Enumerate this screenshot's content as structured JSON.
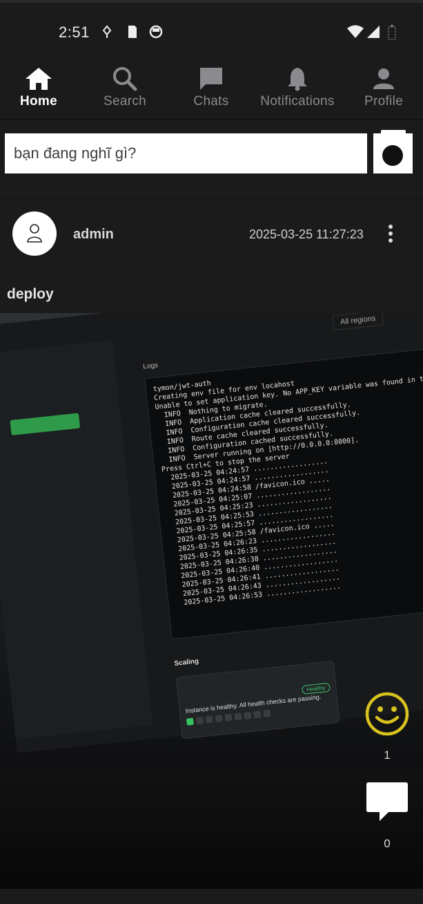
{
  "status_bar": {
    "time": "2:51"
  },
  "nav": {
    "items": [
      {
        "label": "Home",
        "icon": "home-icon",
        "active": true
      },
      {
        "label": "Search",
        "icon": "search-icon",
        "active": false
      },
      {
        "label": "Chats",
        "icon": "chat-icon",
        "active": false
      },
      {
        "label": "Notifications",
        "icon": "bell-icon",
        "active": false
      },
      {
        "label": "Profile",
        "icon": "person-icon",
        "active": false
      }
    ]
  },
  "composer": {
    "placeholder": "bạn đang nghĩ gì?",
    "camera_icon": "camera-icon"
  },
  "post": {
    "username": "admin",
    "timestamp": "2025-03-25 11:27:23",
    "title": "deploy",
    "reactions": {
      "like_count": "1",
      "comment_count": "0"
    },
    "image": {
      "logs_label": "Logs",
      "regions_label": "All regions",
      "scaling_label": "Scaling",
      "health_badge": "Healthy",
      "health_text": "Instance is healthy. All health checks are passing.",
      "log_text": "tymon/jwt-auth\nCreating env file for env locahost\nUnable to set application key. No APP_KEY variable was found in the\n  INFO  Nothing to migrate.\n  INFO  Application cache cleared successfully.\n  INFO  Configuration cache cleared successfully.\n  INFO  Route cache cleared successfully.\n  INFO  Configuration cached successfully.\n  INFO  Server running on [http://0.0.0.0:8000].\nPress Ctrl+C to stop the server\n  2025-03-25 04:24:57 ..................\n  2025-03-25 04:24:57 ..................\n  2025-03-25 04:24:58 /favicon.ico .....\n  2025-03-25 04:25:07 ..................\n  2025-03-25 04:25:23 ..................\n  2025-03-25 04:25:53 ..................\n  2025-03-25 04:25:57 ..................\n  2025-03-25 04:25:58 /favicon.ico .....\n  2025-03-25 04:26:23 ..................\n  2025-03-25 04:26:35 ..................\n  2025-03-25 04:26:38 ..................\n  2025-03-25 04:26:40 ..................\n  2025-03-25 04:26:41 ..................\n  2025-03-25 04:26:43 ..................\n  2025-03-25 04:26:53 .................."
    }
  },
  "colors": {
    "background": "#1b1b1c",
    "active_nav": "#ffffff",
    "inactive_nav": "#8b8b8f",
    "reaction_yellow": "#d8c21e"
  }
}
